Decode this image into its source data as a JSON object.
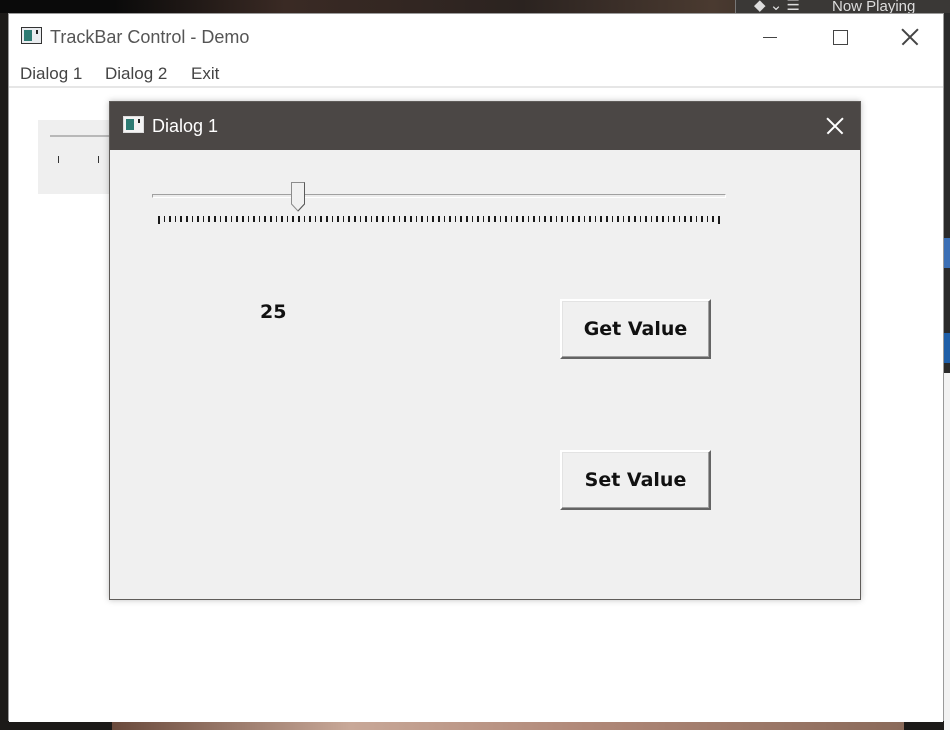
{
  "background": {
    "now_playing_text": "Now Playing",
    "now_playing_symbols": "◆ ⌄ ☰"
  },
  "main_window": {
    "title": "TrackBar Control - Demo",
    "icon": "app-window-icon",
    "controls": {
      "minimize_icon": "minimize-icon",
      "maximize_icon": "maximize-icon",
      "close_icon": "close-icon"
    },
    "menu": [
      {
        "label": "Dialog 1"
      },
      {
        "label": "Dialog 2"
      },
      {
        "label": "Exit"
      }
    ]
  },
  "dialog": {
    "title": "Dialog 1",
    "icon": "app-window-icon",
    "close_icon": "close-icon",
    "trackbar": {
      "min": 0,
      "max": 100,
      "value": 25,
      "tick_count": 101
    },
    "value_label": "25",
    "get_button_label": "Get Value",
    "set_button_label": "Set Value"
  },
  "colors": {
    "dialog_titlebar": "#4b4745",
    "dialog_body": "#f0f0f0",
    "window_body": "#ffffff",
    "icon_accent": "#2d7b73"
  }
}
